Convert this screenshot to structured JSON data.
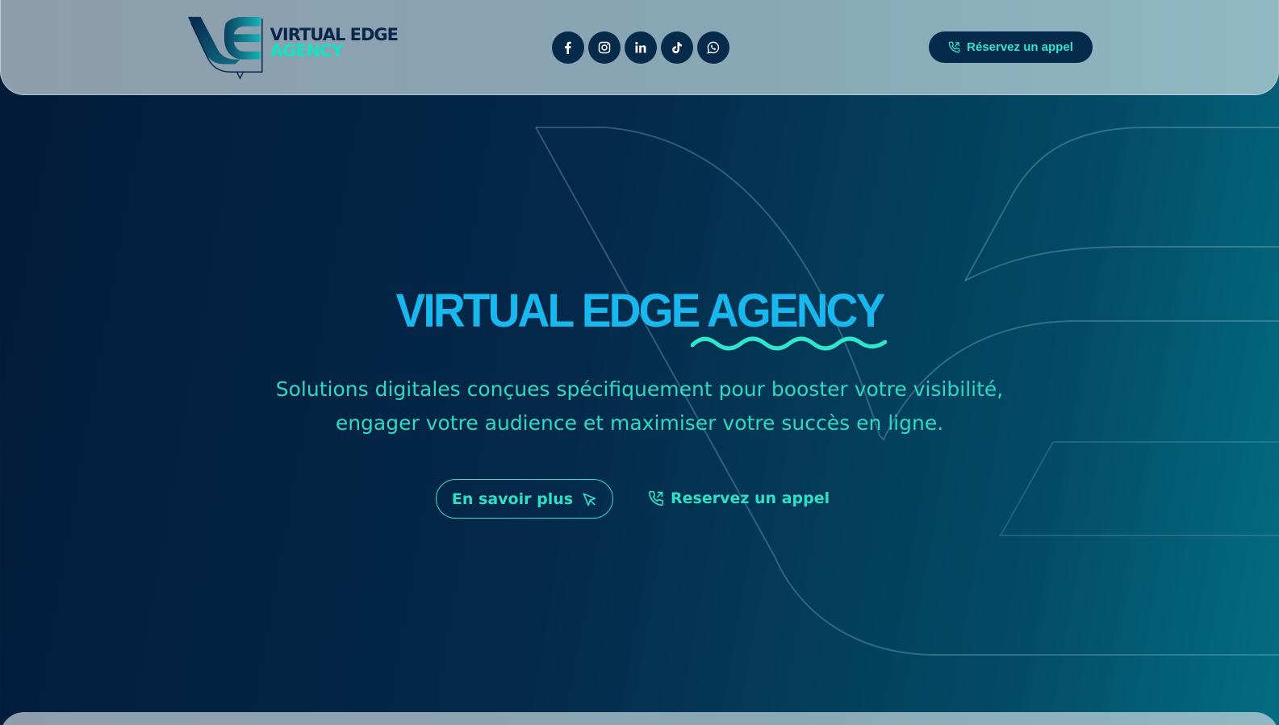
{
  "header": {
    "logo": {
      "line1": "VIRTUAL EDGE",
      "line2": "AGENCY"
    },
    "socials": [
      {
        "name": "facebook",
        "icon": "facebook-icon"
      },
      {
        "name": "instagram",
        "icon": "instagram-icon"
      },
      {
        "name": "linkedin",
        "icon": "linkedin-icon"
      },
      {
        "name": "tiktok",
        "icon": "tiktok-icon"
      },
      {
        "name": "whatsapp",
        "icon": "whatsapp-icon"
      }
    ],
    "cta_label": "Réservez un appel"
  },
  "hero": {
    "title": "VIRTUAL EDGE AGENCY",
    "subtitle_line1": "Solutions digitales conçues spécifiquement pour booster votre visibilité,",
    "subtitle_line2": "engager votre audience et maximiser votre succès en ligne.",
    "learn_more_label": "En savoir plus",
    "call_label": "Reservez un appel"
  },
  "colors": {
    "navy": "#062a4a",
    "teal_accent": "#2ee0c3",
    "title_blue": "#18b8ef",
    "header_gray": "#8ea6b4"
  }
}
